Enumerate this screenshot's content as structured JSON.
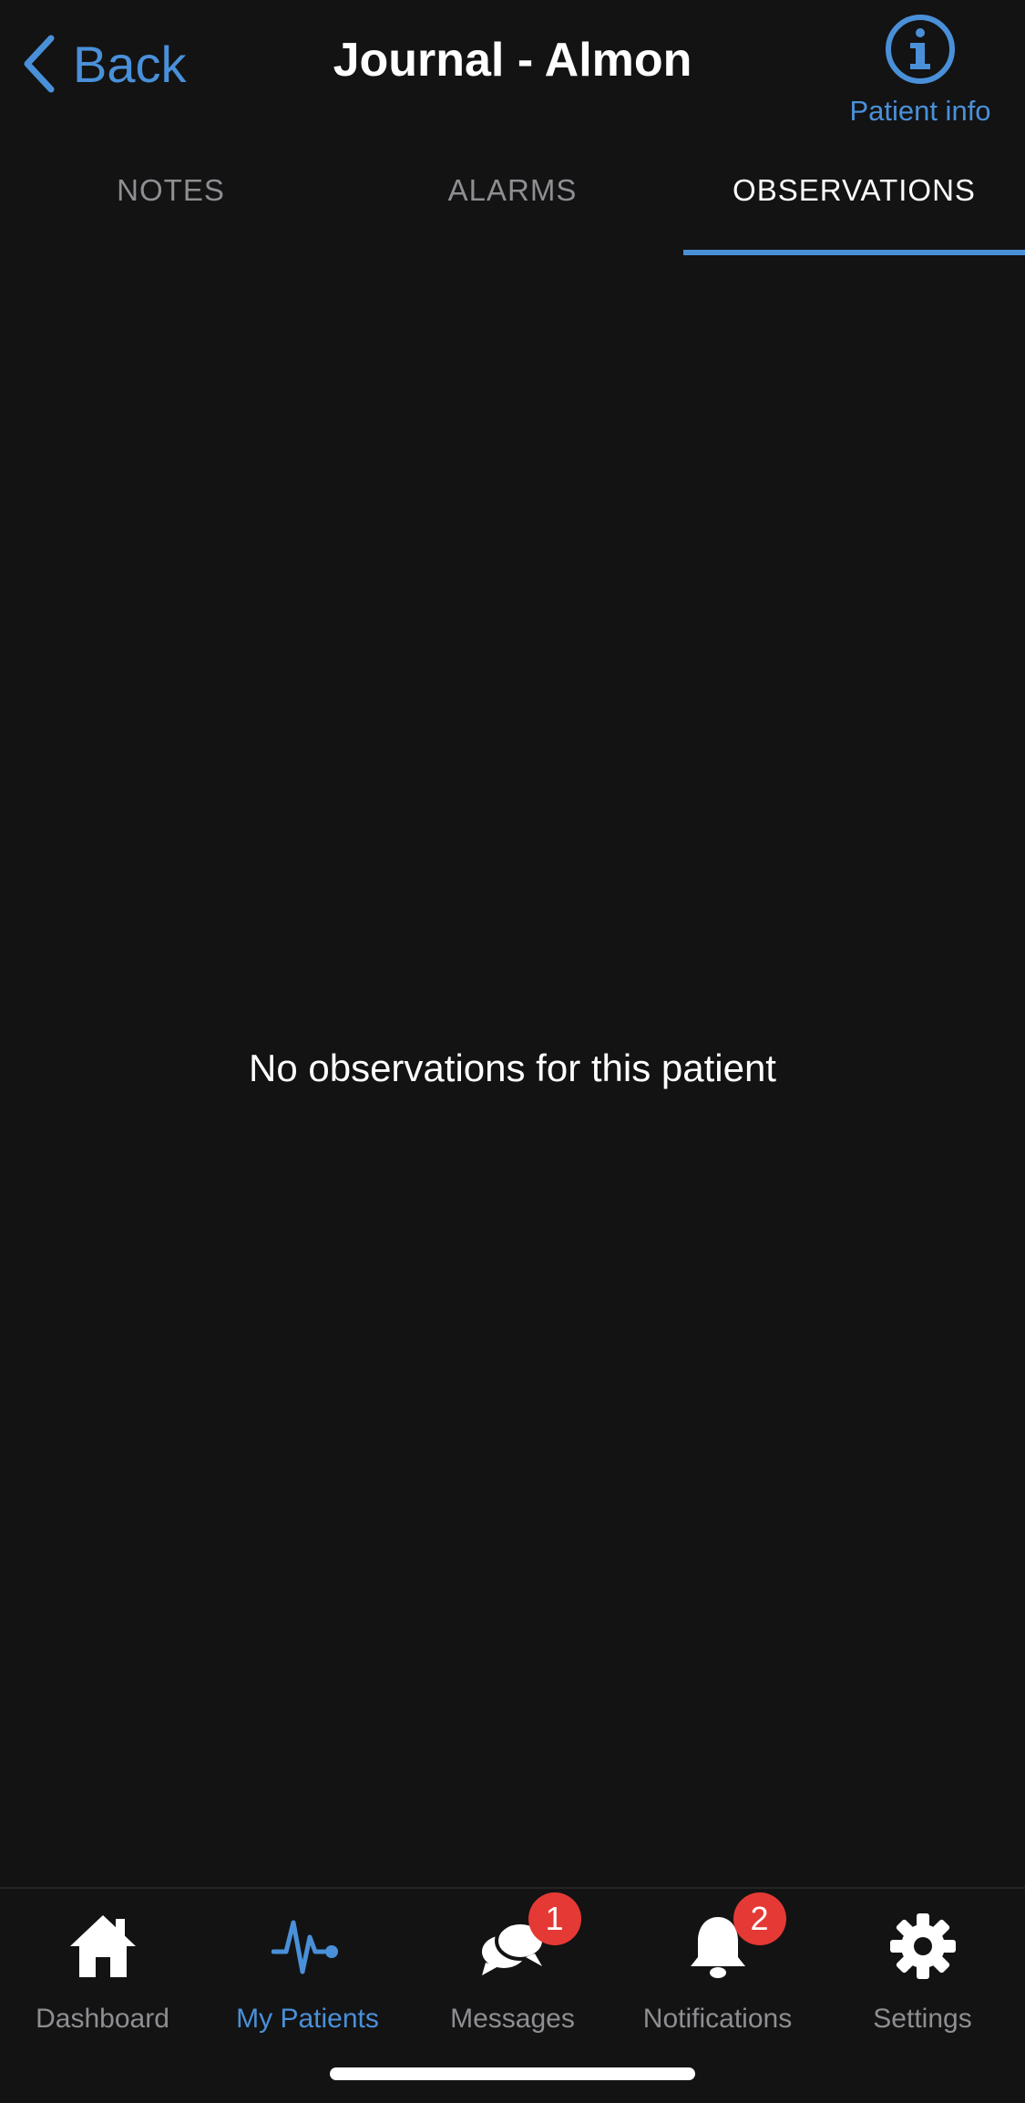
{
  "header": {
    "back_label": "Back",
    "title": "Journal - Almon",
    "info_label": "Patient info"
  },
  "tabs": [
    {
      "label": "NOTES",
      "active": false
    },
    {
      "label": "ALARMS",
      "active": false
    },
    {
      "label": "OBSERVATIONS",
      "active": true
    }
  ],
  "main": {
    "empty_message": "No observations for this patient"
  },
  "tabbar": {
    "items": [
      {
        "label": "Dashboard",
        "icon": "home-icon"
      },
      {
        "label": "My Patients",
        "icon": "heartbeat-icon",
        "active": true
      },
      {
        "label": "Messages",
        "icon": "chat-bubbles-icon",
        "badge": "1"
      },
      {
        "label": "Notifications",
        "icon": "bell-icon",
        "badge": "2"
      },
      {
        "label": "Settings",
        "icon": "gear-icon"
      }
    ]
  },
  "colors": {
    "background": "#131313",
    "accent": "#4a90d9",
    "inactive": "#8e8e93",
    "badge": "#e53935"
  }
}
